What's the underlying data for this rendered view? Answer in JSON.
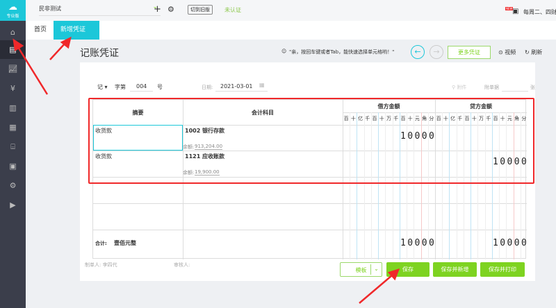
{
  "sidebar": {
    "logo_text": "专业版",
    "items": [
      "home",
      "voucher",
      "report",
      "money",
      "building",
      "chart",
      "store",
      "document",
      "settings",
      "video"
    ]
  },
  "topbar": {
    "company": "民非测试",
    "switch_label": "切到旧版",
    "cert_status": "未认证",
    "news_badge": "NEW",
    "news_text": "每周二、四财"
  },
  "tabs": [
    {
      "label": "首页"
    },
    {
      "label": "新增凭证",
      "close": "×"
    }
  ],
  "page": {
    "title": "记账凭证",
    "hint": "\"亲，按回车键或者Tab，能快速选择单元格哟！\"",
    "more_label": "更多凭证",
    "video_label": "视频",
    "refresh_label": "刷新"
  },
  "voucher": {
    "word": "记",
    "word_label": "字第",
    "number": "004",
    "number_suffix": "号",
    "date_label": "日期:",
    "date": "2021-03-01",
    "attach_label": "附件",
    "bills_label": "附单据",
    "bills_unit": "张"
  },
  "table": {
    "headers": {
      "summary": "摘要",
      "account": "会计科目",
      "debit": "借方金额",
      "credit": "贷方金额"
    },
    "digit_units": [
      "百",
      "十",
      "亿",
      "千",
      "百",
      "十",
      "万",
      "千",
      "百",
      "十",
      "元",
      "角",
      "分"
    ],
    "rows": [
      {
        "summary": "收货款",
        "account": "1002 银行存款",
        "balance_label": "余额:",
        "balance": "913,204.00",
        "debit": "10000",
        "credit": ""
      },
      {
        "summary": "收货款",
        "account": "1121 应收账款",
        "balance_label": "余额:",
        "balance": "19,900.00",
        "debit": "",
        "credit": "10000"
      }
    ],
    "total_label": "合计:",
    "total_words": "壹佰元整",
    "total_debit": "10000",
    "total_credit": "10000"
  },
  "footer": {
    "maker_label": "制单人:",
    "maker": "李四代",
    "reviewer_label": "审核人:",
    "template_label": "模板",
    "save_label": "保存",
    "save_new_label": "保存并新增",
    "save_print_label": "保存并打印"
  },
  "colors": {
    "accent": "#1cc7d9",
    "green": "#7ed321",
    "annotation": "#f0282a"
  }
}
